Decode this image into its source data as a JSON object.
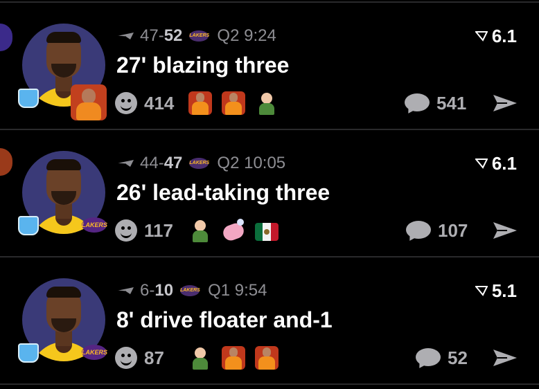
{
  "posts": [
    {
      "score_a": "47",
      "score_sep": "-",
      "score_b": "52",
      "team_logo": "LAKERS",
      "quarter_clock": "Q2 9:24",
      "rating": "6.1",
      "title": "27' blazing three",
      "reaction_count": "414",
      "emojis": [
        "drake-icon",
        "drake-icon",
        "success-kid-icon"
      ],
      "comment_count": "541"
    },
    {
      "score_a": "44",
      "score_sep": "-",
      "score_b": "47",
      "team_logo": "LAKERS",
      "quarter_clock": "Q2 10:05",
      "rating": "6.1",
      "title": "26' lead-taking three",
      "reaction_count": "117",
      "emojis": [
        "success-kid-icon",
        "soap-icon",
        "mexico-flag-icon"
      ],
      "comment_count": "107"
    },
    {
      "score_a": "6",
      "score_sep": "-",
      "score_b": "10",
      "team_logo": "LAKERS",
      "quarter_clock": "Q1 9:54",
      "rating": "5.1",
      "title": "8' drive floater and-1",
      "reaction_count": "87",
      "emojis": [
        "success-kid-icon",
        "drake-icon",
        "drake-icon"
      ],
      "comment_count": "52"
    }
  ],
  "avatar_badge_logo": "LAKERS",
  "colors": {
    "background": "#000000",
    "text_primary": "#ffffff",
    "text_secondary": "#8e8e93",
    "icon_gray": "#aeaeb2",
    "lakers_purple": "#552583",
    "lakers_gold": "#fdb927",
    "divider": "#2a2a2c"
  }
}
